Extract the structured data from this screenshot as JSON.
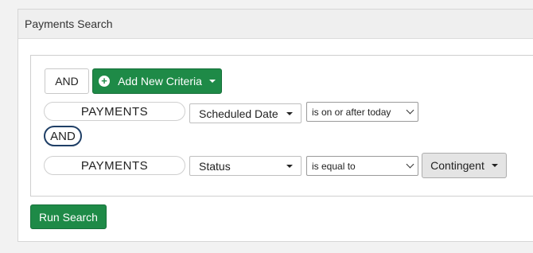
{
  "panel": {
    "title": "Payments Search"
  },
  "toolbar": {
    "and_label": "AND",
    "add_criteria_label": "Add New Criteria"
  },
  "criteria": [
    {
      "entity": "PAYMENTS",
      "field": "Scheduled Date",
      "operator": "is on or after today"
    },
    {
      "connector": "AND"
    },
    {
      "entity": "PAYMENTS",
      "field": "Status",
      "operator": "is equal to",
      "value": "Contingent"
    }
  ],
  "actions": {
    "run_search_label": "Run Search"
  },
  "colors": {
    "primary_green": "#1e8a47",
    "connector_border": "#1f3f66"
  },
  "icons": [
    "plus-circle-icon",
    "caret-down-icon",
    "chevron-down-icon"
  ]
}
